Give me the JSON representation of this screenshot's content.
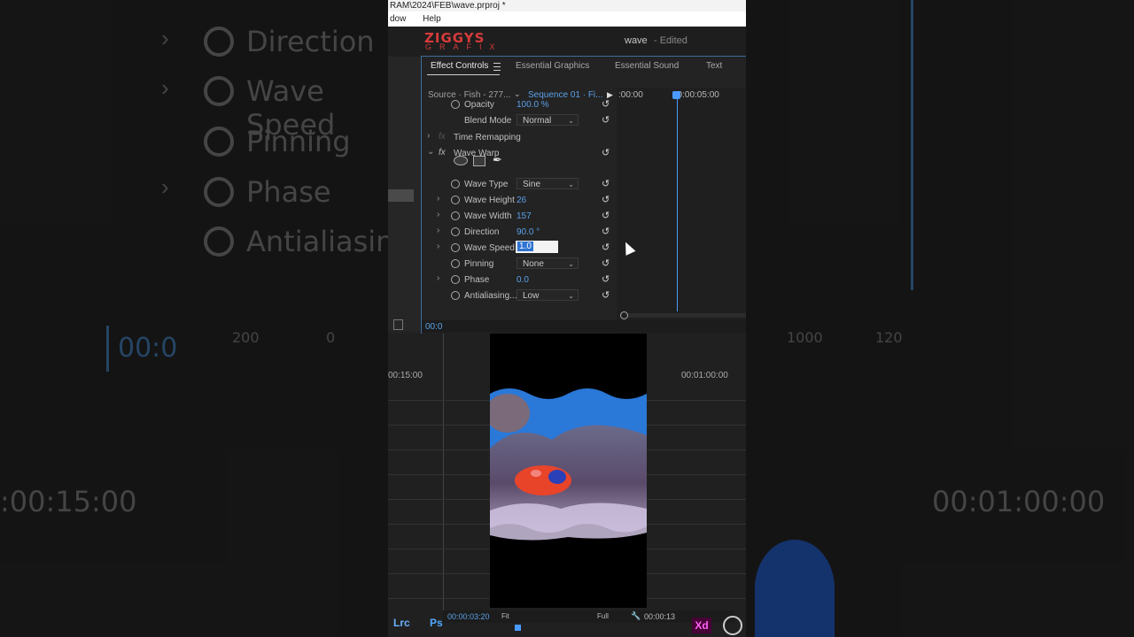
{
  "window": {
    "title_path": "RAM\\2024\\FEB\\wave.prproj *",
    "menu": [
      "dow",
      "Help"
    ]
  },
  "header": {
    "logo_top": "ZIGGYS",
    "logo_bottom": "GRAFIX",
    "project_name": "wave",
    "project_status": "- Edited"
  },
  "tabs": [
    {
      "label": "Effect Controls",
      "active": true
    },
    {
      "label": "Essential Graphics",
      "active": false
    },
    {
      "label": "Essential Sound",
      "active": false
    },
    {
      "label": "Text",
      "active": false
    }
  ],
  "source": {
    "label": "Source · Fish - 277...",
    "sequence": "Sequence 01 · Fi..."
  },
  "properties": {
    "opacity": {
      "label": "Opacity",
      "value": "100.0 %"
    },
    "blend_mode": {
      "label": "Blend Mode",
      "value": "Normal"
    },
    "time_remapping": {
      "label": "Time Remapping"
    },
    "wave_warp": {
      "label": "Wave Warp"
    },
    "wave_type": {
      "label": "Wave Type",
      "value": "Sine"
    },
    "wave_height": {
      "label": "Wave Height",
      "value": "26"
    },
    "wave_width": {
      "label": "Wave Width",
      "value": "157"
    },
    "direction": {
      "label": "Direction",
      "value": "90.0 °"
    },
    "wave_speed": {
      "label": "Wave Speed",
      "value": "1.0"
    },
    "pinning": {
      "label": "Pinning",
      "value": "None"
    },
    "phase": {
      "label": "Phase",
      "value": "0.0"
    },
    "antialiasing": {
      "label": "Antialiasing...",
      "value": "Low"
    }
  },
  "timeline": {
    "start": ":00:00",
    "playhead_time": "00:00:05:00",
    "bottom_tc": "00:0"
  },
  "lower": {
    "left_tc": "00:15:00",
    "right_tc": "00:01:00:00",
    "monitor_tc": "00:00:03:20",
    "fit": "Fit",
    "quality": "Full",
    "duration_tc": "00:00:13"
  },
  "background": {
    "direction": "Direction",
    "wave_speed": "Wave Speed",
    "pinning": "Pinning",
    "phase": "Phase",
    "antialiasing": "Antialiasing.",
    "tc_left": "00:0",
    "tc_big_left": ":00:15:00",
    "tc_big_right": "00:01:00:00",
    "ruler_200": "200",
    "ruler_0": "0",
    "ruler_1000": "1000",
    "ruler_120": "120"
  },
  "taskbar": [
    "Lrc",
    "Ps",
    "Xd"
  ],
  "colors": {
    "accent": "#5aa0e8",
    "logo": "#d63a3a",
    "panel_border": "#3c6ea0"
  }
}
